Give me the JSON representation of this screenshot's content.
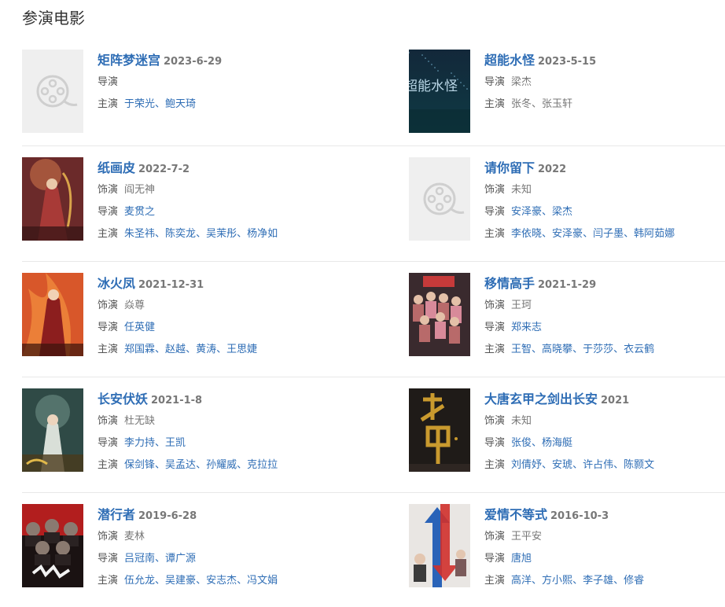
{
  "section_title": "参演电影",
  "labels": {
    "role": "饰演",
    "director": "导演",
    "cast": "主演"
  },
  "films": [
    {
      "title": "矩阵梦迷宫",
      "date": "2023-6-29",
      "poster": "placeholder-icon",
      "role": "",
      "directors": [],
      "cast": [
        "于荣光",
        "鲍天琦"
      ]
    },
    {
      "title": "超能水怪",
      "date": "2023-5-15",
      "poster": "dark-teal-poster",
      "poster_text": "超能水怪",
      "role": "",
      "directors_plain": [
        "梁杰"
      ],
      "cast_plain": [
        "张冬",
        "张玉轩"
      ]
    },
    {
      "title": "纸画皮",
      "date": "2022-7-2",
      "poster": "red-fantasy-poster",
      "role": "阎无神",
      "directors": [
        "麦贯之"
      ],
      "cast": [
        "朱圣祎",
        "陈奕龙",
        "吴茉彤",
        "杨净如"
      ]
    },
    {
      "title": "请你留下",
      "date": "2022",
      "poster": "placeholder-icon",
      "role": "未知",
      "directors": [
        "安泽豪",
        "梁杰"
      ],
      "cast": [
        "李依晓",
        "安泽豪",
        "闫子墨",
        "韩阿茹娜"
      ]
    },
    {
      "title": "冰火凤",
      "date": "2021-12-31",
      "poster": "orange-fire-poster",
      "role": "焱尊",
      "directors": [
        "任英健"
      ],
      "cast": [
        "郑国霖",
        "赵越",
        "黄涛",
        "王思婕"
      ]
    },
    {
      "title": "移情高手",
      "date": "2021-1-29",
      "poster": "group-photo-poster",
      "role": "王珂",
      "directors": [
        "郑来志"
      ],
      "cast": [
        "王智",
        "高晓攀",
        "于莎莎",
        "衣云鹤"
      ]
    },
    {
      "title": "长安伏妖",
      "date": "2021-1-8",
      "poster": "green-ancient-poster",
      "role": "杜无缺",
      "directors": [
        "李力持",
        "王凯"
      ],
      "cast": [
        "保剑锋",
        "吴孟达",
        "孙耀威",
        "克拉拉"
      ]
    },
    {
      "title": "大唐玄甲之剑出长安",
      "date": "2021",
      "poster": "dark-gold-calligraphy-poster",
      "role": "未知",
      "directors": [
        "张俊",
        "杨海艇"
      ],
      "cast": [
        "刘倩妤",
        "安琥",
        "许占伟",
        "陈颢文"
      ]
    },
    {
      "title": "潜行者",
      "date": "2019-6-28",
      "poster": "red-black-action-poster",
      "role": "麦林",
      "directors": [
        "吕冠南",
        "谭广源"
      ],
      "cast": [
        "伍允龙",
        "吴建豪",
        "安志杰",
        "冯文娟"
      ]
    },
    {
      "title": "爱情不等式",
      "date": "2016-10-3",
      "poster": "red-blue-arrows-poster",
      "role": "王平安",
      "directors": [
        "唐旭"
      ],
      "cast": [
        "高洋",
        "方小熙",
        "李子雄",
        "修睿"
      ]
    }
  ]
}
